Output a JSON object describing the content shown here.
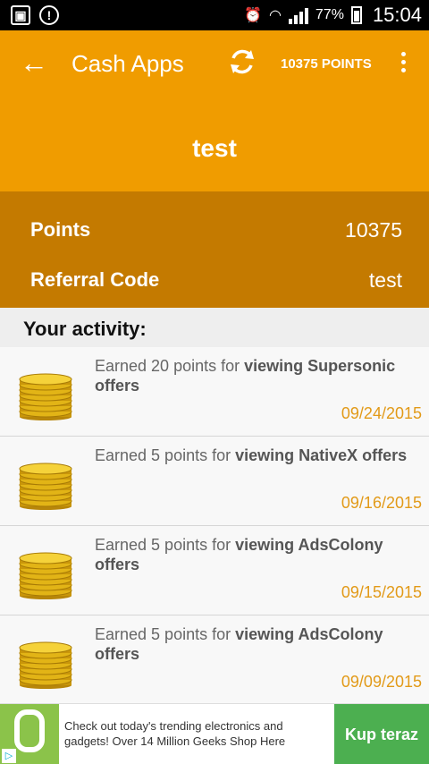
{
  "status_bar": {
    "battery": "77%",
    "time": "15:04",
    "roaming": "R"
  },
  "app_bar": {
    "title": "Cash Apps",
    "points_label": "10375 POINTS"
  },
  "profile": {
    "name": "test",
    "points_label": "Points",
    "points_value": "10375",
    "referral_label": "Referral Code",
    "referral_value": "test"
  },
  "activity": {
    "header": "Your activity:",
    "items": [
      {
        "prefix": "Earned 20 points for ",
        "bold": "viewing Supersonic offers",
        "date": "09/24/2015"
      },
      {
        "prefix": "Earned 5 points for ",
        "bold": "viewing NativeX offers",
        "date": "09/16/2015"
      },
      {
        "prefix": "Earned 5 points for ",
        "bold": "viewing AdsColony offers",
        "date": "09/15/2015"
      },
      {
        "prefix": "Earned 5 points for ",
        "bold": "viewing AdsColony offers",
        "date": "09/09/2015"
      }
    ]
  },
  "ad": {
    "text": "Check out today's trending electronics and gadgets! Over 14 Million Geeks Shop Here",
    "cta": "Kup teraz"
  },
  "colors": {
    "primary": "#f09c00",
    "primary_dark": "#c47a00",
    "date": "#e29a18",
    "ad_green": "#4caf50"
  }
}
